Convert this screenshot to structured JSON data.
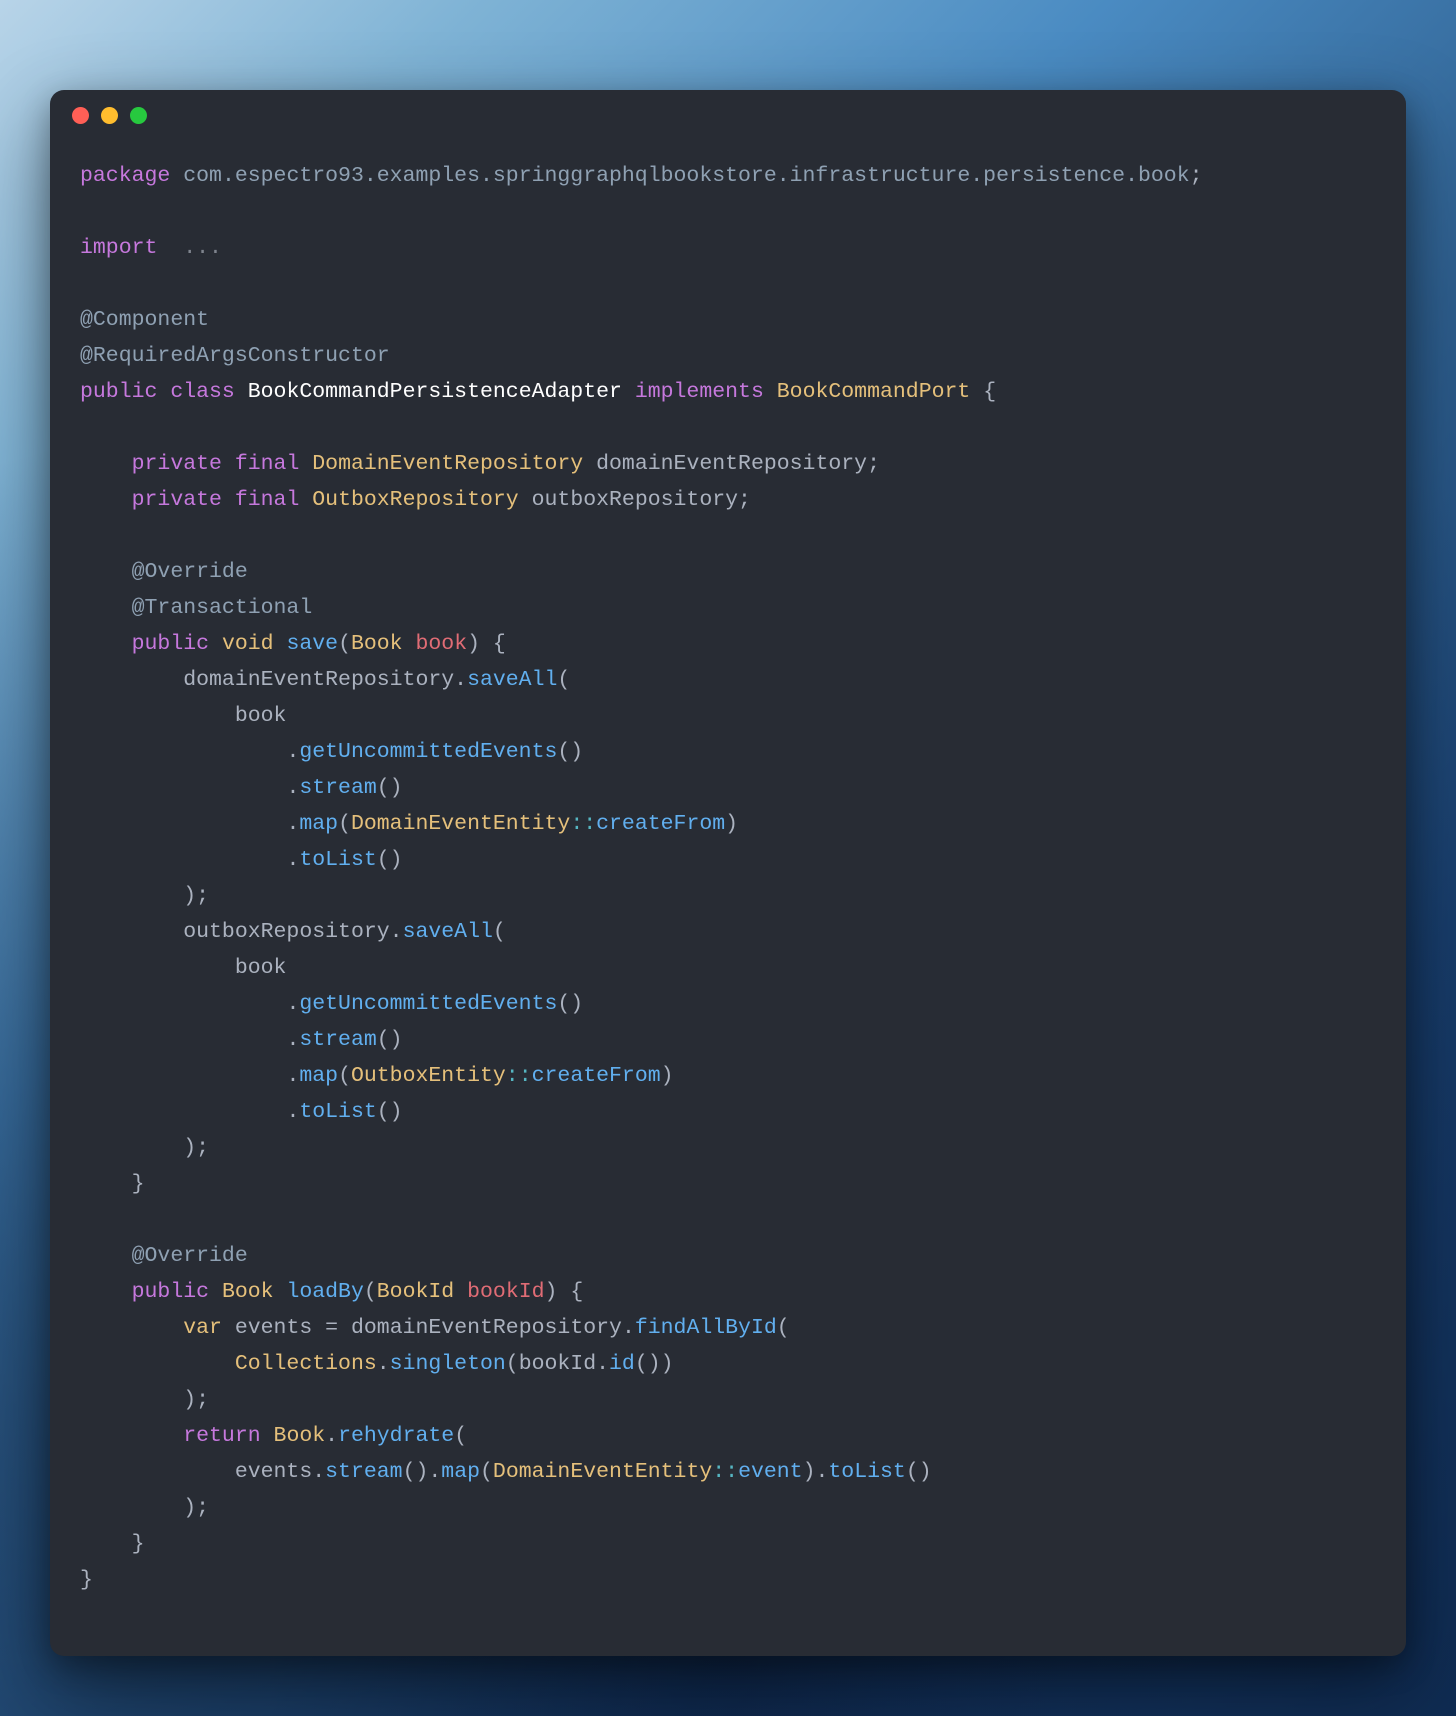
{
  "code": {
    "package_kw": "package",
    "package_name": "com.espectro93.examples.springgraphqlbookstore.infrastructure.persistence.book",
    "import_kw": "import",
    "import_ellipsis": "...",
    "ann_component": "@Component",
    "ann_required": "@RequiredArgsConstructor",
    "public_kw": "public",
    "class_kw": "class",
    "class_name": "BookCommandPersistenceAdapter",
    "implements_kw": "implements",
    "interface_name": "BookCommandPort",
    "private_kw": "private",
    "final_kw": "final",
    "type_domain_repo": "DomainEventRepository",
    "field_domain_repo": "domainEventRepository",
    "type_outbox_repo": "OutboxRepository",
    "field_outbox_repo": "outboxRepository",
    "ann_override": "@Override",
    "ann_transactional": "@Transactional",
    "void_kw": "void",
    "save_method": "save",
    "type_book": "Book",
    "param_book": "book",
    "saveAll": "saveAll",
    "getUncommittedEvents": "getUncommittedEvents",
    "stream": "stream",
    "map": "map",
    "type_domain_event_entity": "DomainEventEntity",
    "createFrom": "createFrom",
    "toList": "toList",
    "type_outbox_entity": "OutboxEntity",
    "loadBy": "loadBy",
    "type_bookid": "BookId",
    "param_bookid": "bookId",
    "var_kw": "var",
    "var_events": "events",
    "findAllById": "findAllById",
    "type_collections": "Collections",
    "singleton": "singleton",
    "id_method": "id",
    "return_kw": "return",
    "rehydrate": "rehydrate",
    "event_method": "event",
    "dcolon": "::"
  }
}
